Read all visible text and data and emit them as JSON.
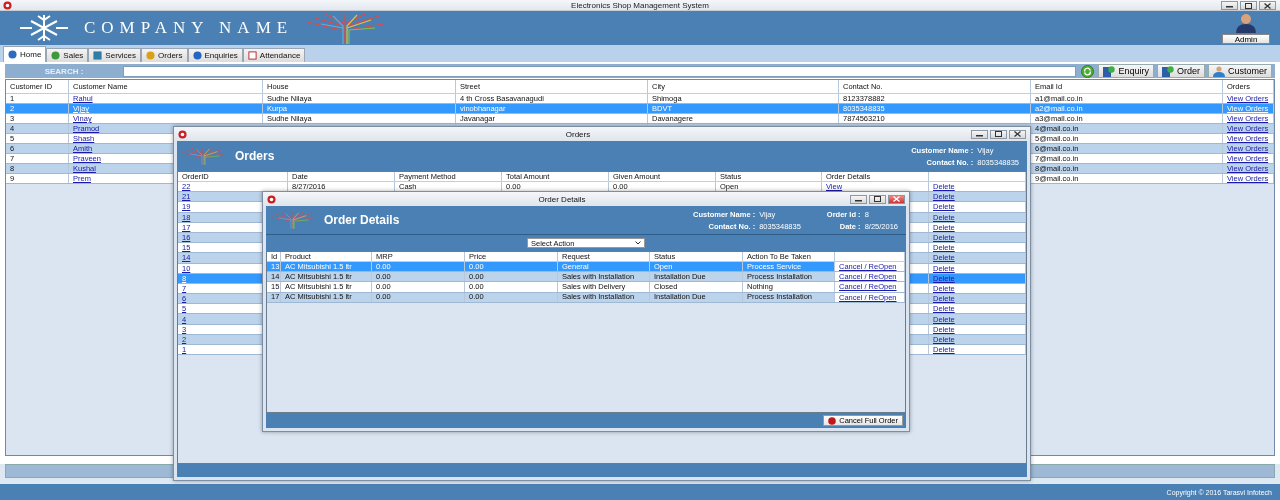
{
  "window": {
    "title": "Electronics Shop Management System"
  },
  "header": {
    "company": "COMPANY NAME",
    "user": "Admin"
  },
  "tabs": [
    {
      "label": "Home",
      "selected": true
    },
    {
      "label": "Sales",
      "selected": false
    },
    {
      "label": "Services",
      "selected": false
    },
    {
      "label": "Orders",
      "selected": false
    },
    {
      "label": "Enquiries",
      "selected": false
    },
    {
      "label": "Attendance",
      "selected": false
    }
  ],
  "search": {
    "label": "SEARCH :",
    "actions": [
      "Enquiry",
      "Order",
      "Customer"
    ]
  },
  "customers": {
    "columns": [
      "Customer ID",
      "Customer Name",
      "House",
      "Street",
      "City",
      "Contact No.",
      "Email Id",
      "Orders"
    ],
    "rows": [
      {
        "id": "1",
        "name": "Rahul",
        "house": "Sudhe Nilaya",
        "street": "4 th Cross Basavanagudi",
        "city": "Shimoga",
        "contact": "8123378882",
        "email": "a1@mail.co.in",
        "orders": "View Orders",
        "selected": false
      },
      {
        "id": "2",
        "name": "Vijay",
        "house": "Kurpa",
        "street": "vinobhanagar",
        "city": "BDVT",
        "contact": "8035348835",
        "email": "a2@mail.co.in",
        "orders": "View Orders",
        "selected": true
      },
      {
        "id": "3",
        "name": "Vinay",
        "house": "Sudhe Nilaya",
        "street": "Javanagar",
        "city": "Davanagere",
        "contact": "7874563210",
        "email": "a3@mail.co.in",
        "orders": "View Orders",
        "selected": false
      },
      {
        "id": "4",
        "name": "Pramod",
        "email": "4@mail.co.in",
        "orders": "View Orders",
        "selected": false
      },
      {
        "id": "5",
        "name": "Shash",
        "email": "5@mail.co.in",
        "orders": "View Orders",
        "selected": false
      },
      {
        "id": "6",
        "name": "Amith",
        "email": "6@mail.co.in",
        "orders": "View Orders",
        "selected": false
      },
      {
        "id": "7",
        "name": "Praveen",
        "email": "7@mail.co.in",
        "orders": "View Orders",
        "selected": false
      },
      {
        "id": "8",
        "name": "Kushal",
        "email": "8@mail.co.in",
        "orders": "View Orders",
        "selected": false
      },
      {
        "id": "9",
        "name": "Prem",
        "email": "9@mail.co.in",
        "orders": "View Orders",
        "selected": false
      }
    ]
  },
  "orders_window": {
    "title": "Orders",
    "heading": "Orders",
    "customer_label": "Customer Name :",
    "customer": "Vijay",
    "contact_label": "Contact No. :",
    "contact": "8035348835",
    "columns": [
      "OrderID",
      "Date",
      "Payment Method",
      "Total Amount",
      "Given Amount",
      "Status",
      "Order Details"
    ],
    "rows": [
      {
        "id": "22",
        "date": "8/27/2016",
        "payment": "Cash",
        "total": "0.00",
        "given": "0.00",
        "status": "Open",
        "details": "View",
        "delete": "Delete",
        "selected": false
      },
      {
        "id": "21",
        "delete": "Delete",
        "selected": false
      },
      {
        "id": "19",
        "delete": "Delete",
        "selected": false
      },
      {
        "id": "18",
        "delete": "Delete",
        "selected": false
      },
      {
        "id": "17",
        "delete": "Delete",
        "selected": false
      },
      {
        "id": "16",
        "delete": "Delete",
        "selected": false
      },
      {
        "id": "15",
        "delete": "Delete",
        "selected": false
      },
      {
        "id": "14",
        "delete": "Delete",
        "selected": false
      },
      {
        "id": "10",
        "delete": "Delete",
        "selected": false
      },
      {
        "id": "8",
        "delete": "Delete",
        "selected": true
      },
      {
        "id": "7",
        "delete": "Delete",
        "selected": false
      },
      {
        "id": "6",
        "delete": "Delete",
        "selected": false
      },
      {
        "id": "5",
        "delete": "Delete",
        "selected": false
      },
      {
        "id": "4",
        "delete": "Delete",
        "selected": false
      },
      {
        "id": "3",
        "delete": "Delete",
        "selected": false
      },
      {
        "id": "2",
        "delete": "Delete",
        "selected": false
      },
      {
        "id": "1",
        "delete": "Delete",
        "selected": false
      }
    ]
  },
  "order_details_window": {
    "title": "Order Details",
    "heading": "Order Details",
    "customer_label": "Customer Name :",
    "customer": "Vijay",
    "contact_label": "Contact No. :",
    "contact": "8035348835",
    "order_label": "Order Id :",
    "order_id": "8",
    "date_label": "Date :",
    "date": "8/25/2016",
    "select": "Select Action",
    "columns": [
      "Id",
      "Product",
      "MRP",
      "Price",
      "Request",
      "Status",
      "Action To Be Taken"
    ],
    "rows": [
      {
        "id": "13",
        "product": "AC Mitsubishi 1.5 ltr",
        "mrp": "0.00",
        "price": "0.00",
        "request": "General",
        "status": "Open",
        "action": "Process Service",
        "link": "Cancel  /  ReOpen",
        "selected": true
      },
      {
        "id": "14",
        "product": "AC Mitsubishi 1.5 ltr",
        "mrp": "0.00",
        "price": "0.00",
        "request": "Sales with Installation",
        "status": "Installation Due",
        "action": "Process Installation",
        "link": "Cancel  /  ReOpen",
        "selected": false
      },
      {
        "id": "15",
        "product": "AC Mitsubishi 1.5 ltr",
        "mrp": "0.00",
        "price": "0.00",
        "request": "Sales with Delivery",
        "status": "Closed",
        "action": "Nothing",
        "link": "Cancel  /  ReOpen",
        "selected": false
      },
      {
        "id": "17",
        "product": "AC Mitsubishi 1.5 ltr",
        "mrp": "0.00",
        "price": "0.00",
        "request": "Sales with Installation",
        "status": "Installation Due",
        "action": "Process Installation",
        "link": "Cancel  /  ReOpen",
        "selected": false
      }
    ],
    "cancel_button": "Cancel Full Order"
  },
  "footer": "Copyright ©  2016  Tarasvi Infotech"
}
